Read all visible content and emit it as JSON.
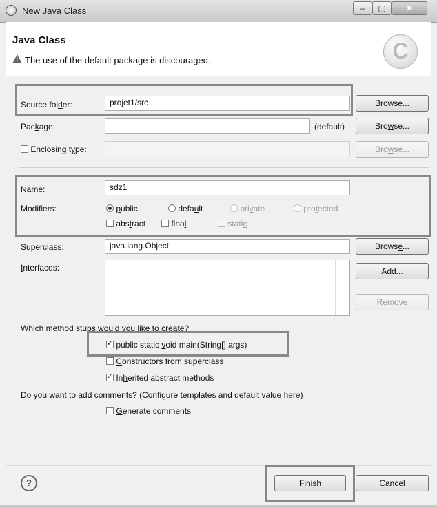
{
  "window": {
    "title": "New Java Class"
  },
  "header": {
    "title": "Java Class",
    "message": "The use of the default package is discouraged."
  },
  "source_folder": {
    "label": "Source folder:",
    "value": "projet1/src",
    "browse": "Browse..."
  },
  "package": {
    "label": "Package:",
    "value": "",
    "suffix": "(default)",
    "browse": "Browse..."
  },
  "enclosing_type": {
    "label": "Enclosing type:",
    "value": "",
    "browse": "Browse..."
  },
  "name": {
    "label": "Name:",
    "value": "sdz1"
  },
  "modifiers": {
    "label": "Modifiers:",
    "access": [
      "public",
      "default",
      "private",
      "protected"
    ],
    "selected": "public",
    "abstract": "abstract",
    "final": "final",
    "static": "static"
  },
  "superclass": {
    "label": "Superclass:",
    "value": "java.lang.Object",
    "browse": "Browse..."
  },
  "interfaces": {
    "label": "Interfaces:",
    "add": "Add...",
    "remove": "Remove"
  },
  "stubs": {
    "question": "Which method stubs would you like to create?",
    "main": "public static void main(String[] args)",
    "constructors": "Constructors from superclass",
    "inherited": "Inherited abstract methods"
  },
  "comments": {
    "question_pre": "Do you want to add comments? (Configure templates and default value ",
    "link": "here",
    "question_post": ")",
    "generate": "Generate comments"
  },
  "footer": {
    "help": "?",
    "finish": "Finish",
    "cancel": "Cancel"
  }
}
